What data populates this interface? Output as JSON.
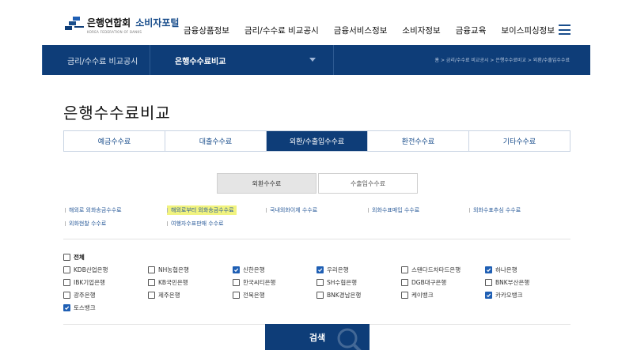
{
  "header": {
    "logo_main": "은행연합회",
    "logo_sub": "소비자포털",
    "logo_eng": "KOREA FEDERATION OF BANKS",
    "nav": [
      "금융상품정보",
      "금리/수수료 비교공시",
      "금융서비스정보",
      "소비자정보",
      "금융교육",
      "보이스피싱정보"
    ]
  },
  "subbar": {
    "category": "금리/수수료 비교공시",
    "current": "은행수수료비교",
    "breadcrumb": "홈  >  금리/수수료 비교공시  >  은행수수료비교  >  외환/수출입수수료"
  },
  "page_title": "은행수수료비교",
  "tabs": [
    {
      "label": "예금수수료",
      "active": false
    },
    {
      "label": "대출수수료",
      "active": false
    },
    {
      "label": "외환/수출입수수료",
      "active": true
    },
    {
      "label": "환전수수료",
      "active": false
    },
    {
      "label": "기타수수료",
      "active": false
    }
  ],
  "subtabs": {
    "selected": "외환수수료",
    "other": "수출입수수료"
  },
  "sub_items": [
    "해외로 외화송금수수료",
    "해외로부터 외화송금수수료",
    "국내외화이체 수수료",
    "외화수표매입 수수료",
    "외화수표추심 수수료",
    "외화현찰 수수료",
    "여행자수표판매 수수료"
  ],
  "select_all": {
    "label": "전체",
    "checked": false
  },
  "banks": [
    {
      "name": "KDB산업은행",
      "checked": false
    },
    {
      "name": "NH농협은행",
      "checked": false
    },
    {
      "name": "신한은행",
      "checked": true
    },
    {
      "name": "우리은행",
      "checked": true
    },
    {
      "name": "스탠다드차타드은행",
      "checked": false
    },
    {
      "name": "하나은행",
      "checked": true
    },
    {
      "name": "IBK기업은행",
      "checked": false
    },
    {
      "name": "KB국민은행",
      "checked": false
    },
    {
      "name": "한국씨티은행",
      "checked": false
    },
    {
      "name": "SH수협은행",
      "checked": false
    },
    {
      "name": "DGB대구은행",
      "checked": false
    },
    {
      "name": "BNK부산은행",
      "checked": false
    },
    {
      "name": "광주은행",
      "checked": false
    },
    {
      "name": "제주은행",
      "checked": false
    },
    {
      "name": "전북은행",
      "checked": false
    },
    {
      "name": "BNK경남은행",
      "checked": false
    },
    {
      "name": "케이뱅크",
      "checked": false
    },
    {
      "name": "카카오뱅크",
      "checked": true
    },
    {
      "name": "토스뱅크",
      "checked": true
    }
  ],
  "search_label": "검색",
  "colors": {
    "navy": "#0e3d78",
    "accent_blue": "#1a4e8c",
    "checkbox": "#1f5fb4",
    "highlight": "#f1f37f"
  }
}
